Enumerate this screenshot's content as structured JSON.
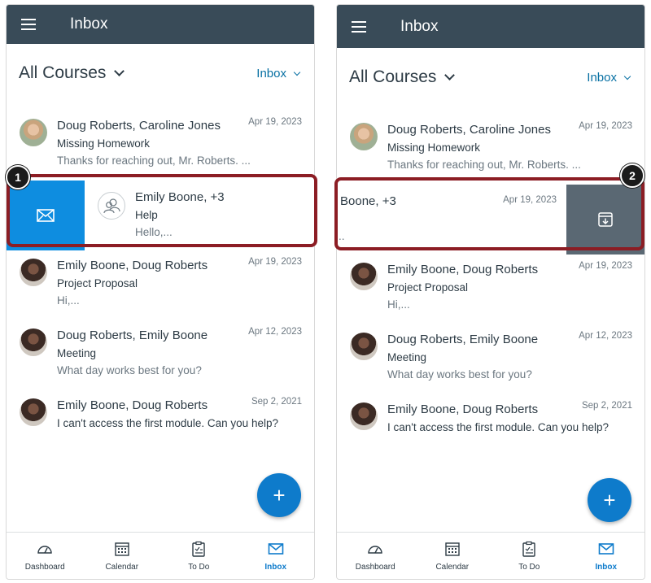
{
  "left": {
    "topbar": {
      "title": "Inbox"
    },
    "filter": {
      "courses": "All Courses",
      "mailbox": "Inbox"
    },
    "messages": [
      {
        "from": "Doug Roberts, Caroline Jones",
        "date": "Apr 19, 2023",
        "subject": "Missing Homework",
        "preview": "Thanks for reaching out, Mr. Roberts. ..."
      },
      {
        "from": "Emily Boone, +3",
        "date": "",
        "subject": "Help",
        "preview": "Hello,..."
      },
      {
        "from": "Emily Boone, Doug Roberts",
        "date": "Apr 19, 2023",
        "subject": "Project Proposal",
        "preview": "Hi,..."
      },
      {
        "from": "Doug Roberts, Emily Boone",
        "date": "Apr 12, 2023",
        "subject": "Meeting",
        "preview": "What day works best for you?"
      },
      {
        "from": "Emily Boone, Doug Roberts",
        "date": "Sep 2, 2021",
        "subject": "",
        "preview": "I can't access the first module. Can you help?"
      }
    ],
    "step": "1",
    "swipe_action_icon": "mail-icon"
  },
  "right": {
    "topbar": {
      "title": "Inbox"
    },
    "filter": {
      "courses": "All Courses",
      "mailbox": "Inbox"
    },
    "messages": [
      {
        "from": "Doug Roberts, Caroline Jones",
        "date": "Apr 19, 2023",
        "subject": "Missing Homework",
        "preview": "Thanks for reaching out, Mr. Roberts. ..."
      },
      {
        "from": "Boone, +3",
        "date": "Apr 19, 2023",
        "subject": "",
        "preview": ".."
      },
      {
        "from": "Emily Boone, Doug Roberts",
        "date": "Apr 19, 2023",
        "subject": "Project Proposal",
        "preview": "Hi,..."
      },
      {
        "from": "Doug Roberts, Emily Boone",
        "date": "Apr 12, 2023",
        "subject": "Meeting",
        "preview": "What day works best for you?"
      },
      {
        "from": "Emily Boone, Doug Roberts",
        "date": "Sep 2, 2021",
        "subject": "",
        "preview": "I can't access the first module. Can you help?"
      }
    ],
    "step": "2",
    "swipe_action_icon": "archive-icon"
  },
  "fab": {
    "label": "+"
  },
  "tabs": [
    {
      "label": "Dashboard",
      "icon": "dashboard-icon"
    },
    {
      "label": "Calendar",
      "icon": "calendar-icon"
    },
    {
      "label": "To Do",
      "icon": "todo-icon"
    },
    {
      "label": "Inbox",
      "icon": "inbox-icon"
    }
  ],
  "colors": {
    "topbar": "#394b58",
    "accent": "#0e7bcb",
    "swipe_read": "#0e8de0",
    "swipe_archive": "#5a6873",
    "highlight": "#8c1d24"
  }
}
